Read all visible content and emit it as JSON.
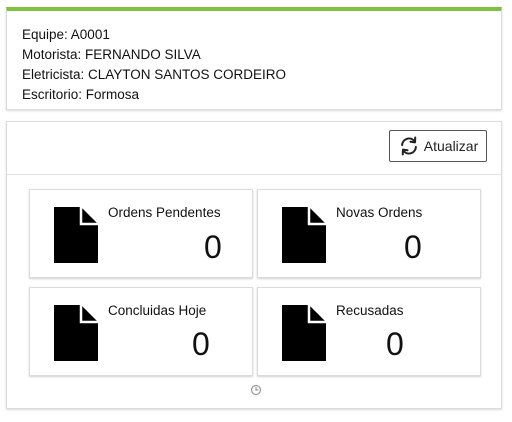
{
  "team_info": {
    "equipe": "Equipe: A0001",
    "motorista": "Motorista: FERNANDO SILVA",
    "eletricista": "Eletricista: CLAYTON SANTOS CORDEIRO",
    "escritorio": "Escritorio: Formosa"
  },
  "toolbar": {
    "refresh_label": "Atualizar",
    "refresh_icon": "refresh-icon"
  },
  "tiles": [
    {
      "label": "Ordens Pendentes",
      "count": "0",
      "icon": "document-icon"
    },
    {
      "label": "Novas Ordens",
      "count": "0",
      "icon": "document-icon"
    },
    {
      "label": "Concluidas Hoje",
      "count": "0",
      "icon": "document-icon"
    },
    {
      "label": "Recusadas",
      "count": "0",
      "icon": "document-icon"
    }
  ],
  "colors": {
    "accent_bar": "#7fc241",
    "icon": "#000000"
  }
}
